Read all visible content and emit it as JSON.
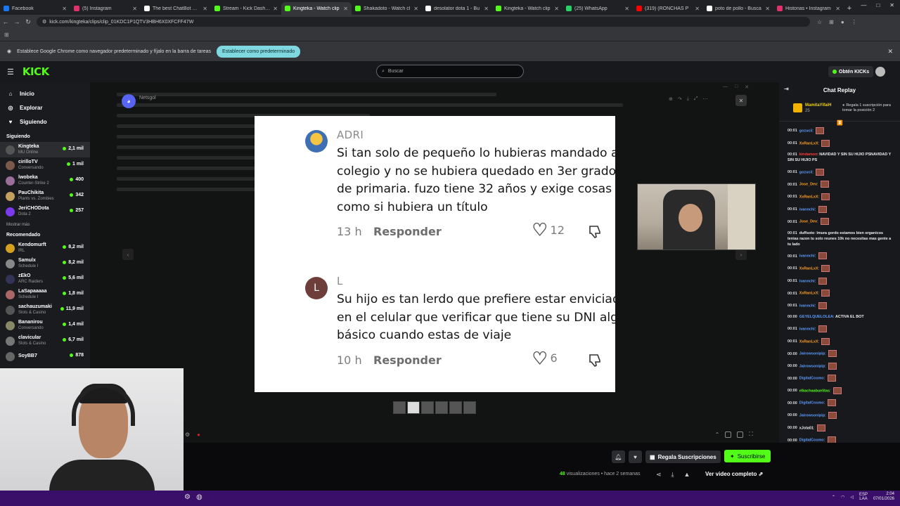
{
  "browser": {
    "tabs": [
      {
        "title": "Facebook",
        "color": "#1877f2"
      },
      {
        "title": "(5) Instagram",
        "color": "#e1306c"
      },
      {
        "title": "The best ChatBot and",
        "color": "#ffffff"
      },
      {
        "title": "Stream - Kick Dashbo",
        "color": "#53fc18"
      },
      {
        "title": "Kingteka - Watch clip",
        "color": "#53fc18"
      },
      {
        "title": "Shakadoto - Watch cl",
        "color": "#53fc18"
      },
      {
        "title": "desolator dota 1 - Bu",
        "color": "#ffffff"
      },
      {
        "title": "Kingteka - Watch clip",
        "color": "#53fc18"
      },
      {
        "title": "(25) WhatsApp",
        "color": "#25d366"
      },
      {
        "title": "(319) (RONCHAS P",
        "color": "#ff0000"
      },
      {
        "title": "poto de pollo - Busca",
        "color": "#ffffff"
      },
      {
        "title": "Historias • Instagram",
        "color": "#e1306c"
      }
    ],
    "active_tab": 4,
    "url": "kick.com/kingteka/clips/clip_01KDC1P1QTV3HBH6X0XFCFF47W",
    "infobar_text": "Establece Google Chrome como navegador predeterminado y fíjalo en la barra de tareas",
    "infobar_button": "Establecer como predeterminado"
  },
  "kick": {
    "logo": "KICK",
    "search_placeholder": "Buscar",
    "get_kicks": "Obtén KICKs",
    "nav": [
      {
        "label": "Inicio",
        "icon": "home-icon"
      },
      {
        "label": "Explorar",
        "icon": "compass-icon"
      },
      {
        "label": "Siguiendo",
        "icon": "heart-icon"
      }
    ],
    "following_title": "Siguiendo",
    "following": [
      {
        "name": "Kingteka",
        "sub": "MU Online",
        "viewers": "2,1 mil",
        "color": "#555"
      },
      {
        "name": "cirilloTV",
        "sub": "Conversando",
        "viewers": "1 mil",
        "color": "#7a5a4a"
      },
      {
        "name": "lwobeka",
        "sub": "Counter-Strike 2",
        "viewers": "400",
        "color": "#9a6f9a"
      },
      {
        "name": "PauChikita",
        "sub": "Plants vs. Zombies",
        "viewers": "342",
        "color": "#c4a060"
      },
      {
        "name": "JeriCHODota",
        "sub": "Dota 2",
        "viewers": "257",
        "color": "#7c3aed"
      }
    ],
    "show_more": "Mostrar más",
    "recommended_title": "Recomendado",
    "recommended": [
      {
        "name": "Kendomurft",
        "sub": "IRL",
        "viewers": "8,2 mil",
        "color": "#d4a020"
      },
      {
        "name": "Samulx",
        "sub": "Schedule I",
        "viewers": "8,2 mil",
        "color": "#888"
      },
      {
        "name": "zEkO",
        "sub": "ARC Raiders",
        "viewers": "5,6 mil",
        "color": "#335"
      },
      {
        "name": "LaSapaaaaa",
        "sub": "Schedule I",
        "viewers": "1,8 mil",
        "color": "#a66"
      },
      {
        "name": "sachauzumaki",
        "sub": "Slots & Casino",
        "viewers": "11,9 mil",
        "color": "#555"
      },
      {
        "name": "Bananirou",
        "sub": "Conversando",
        "viewers": "1,4 mil",
        "color": "#886"
      },
      {
        "name": "clavicular",
        "sub": "Slots & Casino",
        "viewers": "6,7 mil",
        "color": "#777"
      },
      {
        "name": "SoyBB7",
        "sub": "",
        "viewers": "878",
        "color": "#666"
      }
    ]
  },
  "player": {
    "discord_name": "Netsgol",
    "comments": [
      {
        "author": "ADRI",
        "text": "Si tan solo de pequeño lo hubieras mandado al colegio y no se hubiera quedado en 3er grado de primaria. fuzo tiene 32 años y exige cosas como si hubiera un título",
        "time": "13 h",
        "reply": "Responder",
        "likes": "12"
      },
      {
        "author": "L",
        "avatar_letter": "L",
        "text": "Su hijo es tan lerdo que prefiere estar enviciado en el celular que verificar que tiene su DNI algo básico cuando estas de viaje",
        "time": "10 h",
        "reply": "Responder",
        "likes": "6"
      }
    ]
  },
  "chat": {
    "title": "Chat Replay",
    "pinned_user": "MamitaYifaiH",
    "pinned_count": "25",
    "pinned_text": "Regala 1 suscripción para tomar la posición 2",
    "messages": [
      {
        "t": "00:01",
        "u": "gozucii",
        "c": "#5b9bff",
        "text": "",
        "emote": true
      },
      {
        "t": "00:01",
        "u": "XxRanLxX",
        "c": "#ffa020",
        "text": "",
        "emote": true
      },
      {
        "t": "00:01",
        "u": "kindamon",
        "c": "#ff3a3a",
        "text": "NAVIDAD Y SIN SU HIJIO PSNAVIDAD Y SIN SU HIJIO PS",
        "emote": false
      },
      {
        "t": "00:01",
        "u": "gozucii",
        "c": "#5b9bff",
        "text": "",
        "emote": true
      },
      {
        "t": "00:01",
        "u": "Jose_Dev",
        "c": "#ffa020",
        "text": "",
        "emote": true
      },
      {
        "t": "00:01",
        "u": "XxRanLxX",
        "c": "#ffa020",
        "text": "",
        "emote": true
      },
      {
        "t": "00:01",
        "u": "ivannchi",
        "c": "#5b9bff",
        "text": "",
        "emote": true
      },
      {
        "t": "00:01",
        "u": "Jose_Dev",
        "c": "#ffa020",
        "text": "",
        "emote": true
      },
      {
        "t": "00:01",
        "u": "duffsoto",
        "c": "#eeeeee",
        "text": "lmura gordo estamos bien organicos tenias razon tu solo reunes 10k no necesitas mas gente a tu lado",
        "emote": false
      },
      {
        "t": "00:01",
        "u": "ivannchi",
        "c": "#5b9bff",
        "text": "",
        "emote": true
      },
      {
        "t": "00:01",
        "u": "XxRanLxX",
        "c": "#ffa020",
        "text": "",
        "emote": true
      },
      {
        "t": "00:01",
        "u": "ivannchi",
        "c": "#5b9bff",
        "text": "",
        "emote": true
      },
      {
        "t": "00:01",
        "u": "XxRanLxX",
        "c": "#ffa020",
        "text": "",
        "emote": true
      },
      {
        "t": "00:01",
        "u": "ivannchi",
        "c": "#5b9bff",
        "text": "",
        "emote": true
      },
      {
        "t": "00:00",
        "u": "GEYELQUELOLEA",
        "c": "#5b9bff",
        "text": "ACTIVA EL BOT",
        "emote": false
      },
      {
        "t": "00:01",
        "u": "ivannchi",
        "c": "#5b9bff",
        "text": "",
        "emote": true
      },
      {
        "t": "00:01",
        "u": "XxRanLxX",
        "c": "#ffa020",
        "text": "",
        "emote": true
      },
      {
        "t": "00:00",
        "u": "Jairowsonipip",
        "c": "#5b9bff",
        "text": "",
        "emote": true
      },
      {
        "t": "00:00",
        "u": "Jairowsonipip",
        "c": "#5b9bff",
        "text": "",
        "emote": true
      },
      {
        "t": "00:00",
        "u": "DigitalCosmo",
        "c": "#5b9bff",
        "text": "",
        "emote": true
      },
      {
        "t": "00:00",
        "u": "elkachaabuelitas",
        "c": "#53fc18",
        "text": "",
        "emote": true
      },
      {
        "t": "00:00",
        "u": "DigitalCosmo",
        "c": "#5b9bff",
        "text": "",
        "emote": true
      },
      {
        "t": "00:00",
        "u": "Jairowsonipip",
        "c": "#5b9bff",
        "text": "",
        "emote": true
      },
      {
        "t": "00:00",
        "u": "xJota01",
        "c": "#eeeeee",
        "text": "",
        "emote": true
      },
      {
        "t": "00:00",
        "u": "DigitalCosmo",
        "c": "#5b9bff",
        "text": "",
        "emote": true
      }
    ]
  },
  "bottom": {
    "gift_label": "Regala Suscripciones",
    "subscribe_label": "Suscribirse",
    "views_num": "48",
    "views_text": "visualizaciones • hace 2 semanas",
    "full_video": "Ver video completo"
  },
  "taskbar": {
    "lang1": "ESP",
    "lang2": "LAA",
    "time": "2:04",
    "date": "07/01/2026"
  }
}
